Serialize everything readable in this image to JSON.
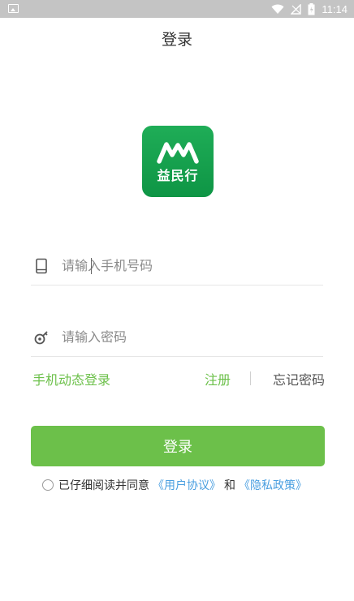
{
  "status_bar": {
    "time": "11:14"
  },
  "header": {
    "title": "登录"
  },
  "logo": {
    "text": "益民行"
  },
  "form": {
    "phone_placeholder": "请输入手机号码",
    "password_placeholder": "请输入密码"
  },
  "links": {
    "sms_login": "手机动态登录",
    "register": "注册",
    "forgot_password": "忘记密码"
  },
  "login_button": "登录",
  "agreement": {
    "prefix": "已仔细阅读并同意",
    "user_agreement": "《用户协议》",
    "and": "和",
    "privacy_policy": "《隐私政策》"
  },
  "colors": {
    "accent": "#6cc04a",
    "logo_green": "#1fad57",
    "link_blue": "#4a9fe0",
    "status_bar": "#c4c4c4"
  }
}
